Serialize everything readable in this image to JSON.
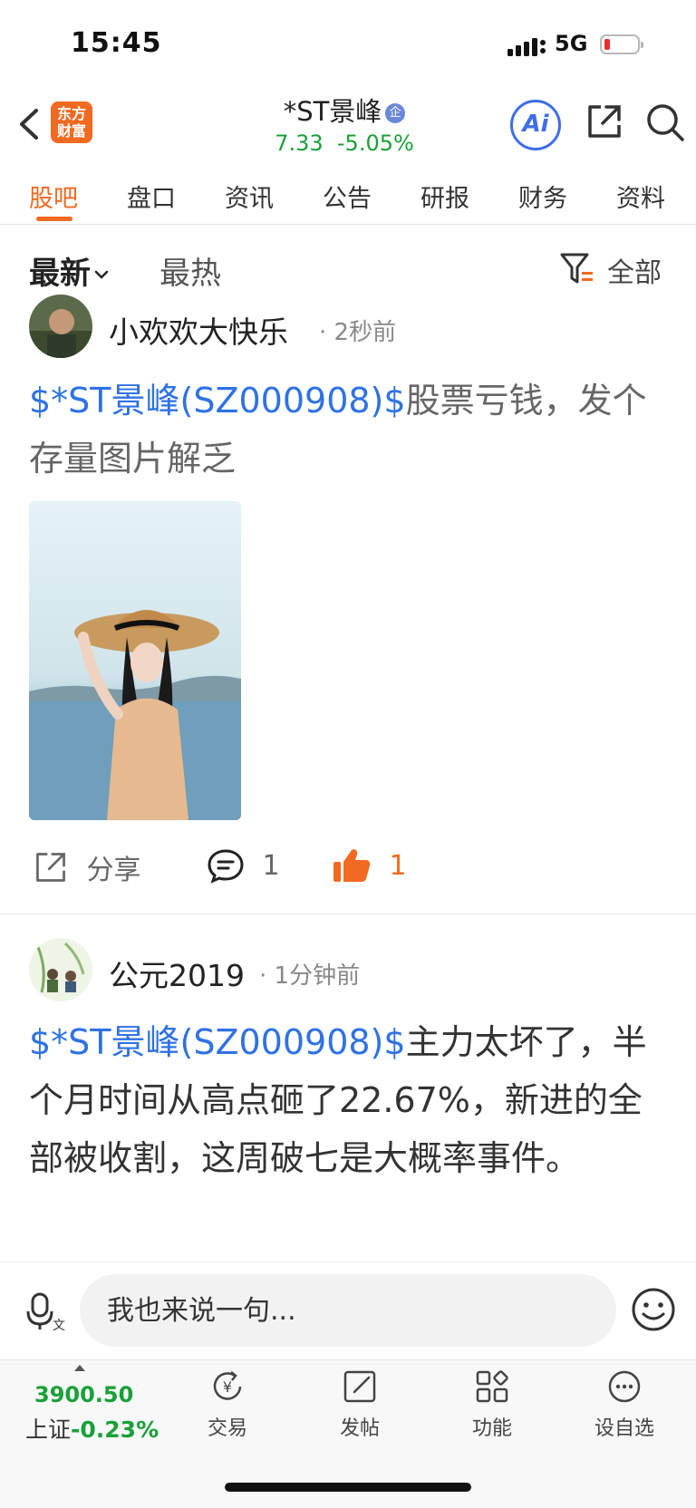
{
  "status_bar": {
    "time": "15:45",
    "network": "5G"
  },
  "header": {
    "logo_line1": "东方",
    "logo_line2": "财富",
    "stock_name": "*ST景峰",
    "stock_badge": "企",
    "price": "7.33",
    "change": "-5.05%",
    "ai_label": "Ai"
  },
  "tabs": [
    {
      "label": "股吧",
      "active": true
    },
    {
      "label": "盘口"
    },
    {
      "label": "资讯"
    },
    {
      "label": "公告"
    },
    {
      "label": "研报"
    },
    {
      "label": "财务"
    },
    {
      "label": "资料"
    }
  ],
  "sort": {
    "latest": "最新",
    "hot": "最热",
    "filter_label": "全部"
  },
  "posts": [
    {
      "username": "小欢欢大快乐",
      "time": "2秒前",
      "link": "$*ST景峰(SZ000908)$",
      "text": "股票亏钱，发个存量图片解乏",
      "share_label": "分享",
      "comment_count": "1",
      "like_count": "1"
    },
    {
      "username": "公元2019",
      "time": "1分钟前",
      "link": "$*ST景峰(SZ000908)$",
      "text": "主力太坏了，半个月时间从高点砸了22.67%，新进的全部被收割，这周破七是大概率事件。"
    }
  ],
  "input": {
    "placeholder": "我也来说一句..."
  },
  "bottom_nav": {
    "index_value": "3900.50",
    "index_name": "上证",
    "index_change": "-0.23%",
    "items": [
      {
        "label": "交易",
        "icon": "yuan-exchange-icon"
      },
      {
        "label": "发帖",
        "icon": "edit-icon"
      },
      {
        "label": "功能",
        "icon": "grid-icon"
      },
      {
        "label": "设自选",
        "icon": "more-icon"
      }
    ]
  },
  "colors": {
    "brand": "#f26a21",
    "down": "#1aa038",
    "link": "#2f72e4",
    "ai": "#3f6de8"
  }
}
